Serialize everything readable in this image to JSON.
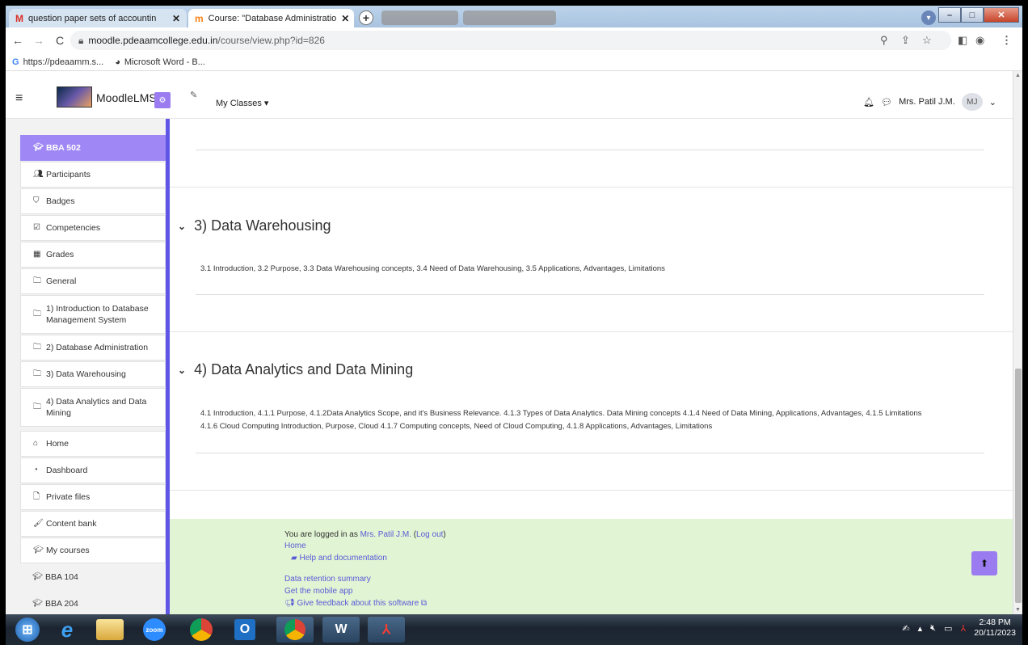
{
  "browser": {
    "tabs": [
      {
        "label": "question paper sets of accountin",
        "icon": "gmail-icon",
        "active": false
      },
      {
        "label": "Course: \"Database Administratio",
        "icon": "moodle-icon",
        "active": true
      }
    ],
    "url_domain": "moodle.pdeaamcollege.edu.in",
    "url_path": "/course/view.php?id=826",
    "bookmarks": [
      {
        "label": "https://pdeaamm.s...",
        "icon": "google-icon"
      },
      {
        "label": "Microsoft Word - B...",
        "icon": "globe-icon"
      }
    ]
  },
  "header": {
    "brand": "MoodleLMS",
    "my_classes": "My Classes ▾",
    "user_name": "Mrs. Patil J.M.",
    "user_initials": "MJ"
  },
  "sidebar": {
    "items": [
      {
        "label": "BBA 502",
        "icon": "graduation-cap-icon",
        "active": true
      },
      {
        "label": "Participants",
        "icon": "users-icon"
      },
      {
        "label": "Badges",
        "icon": "shield-icon"
      },
      {
        "label": "Competencies",
        "icon": "check-square-icon"
      },
      {
        "label": "Grades",
        "icon": "table-icon"
      },
      {
        "label": "General",
        "icon": "folder-icon"
      },
      {
        "label": "1) Introduction to Database Management System",
        "icon": "folder-icon"
      },
      {
        "label": "2) Database Administration",
        "icon": "folder-icon"
      },
      {
        "label": "3) Data Warehousing",
        "icon": "folder-icon"
      },
      {
        "label": "4) Data Analytics and Data Mining",
        "icon": "folder-icon"
      },
      {
        "label": "Home",
        "icon": "home-icon"
      },
      {
        "label": "Dashboard",
        "icon": "dashboard-icon"
      },
      {
        "label": "Private files",
        "icon": "file-icon"
      },
      {
        "label": "Content bank",
        "icon": "brush-icon"
      },
      {
        "label": "My courses",
        "icon": "graduation-cap-icon"
      },
      {
        "label": "BBA 104",
        "icon": "graduation-cap-icon"
      },
      {
        "label": "BBA 204",
        "icon": "graduation-cap-icon"
      }
    ]
  },
  "sections": [
    {
      "title": "3) Data Warehousing",
      "summary_lines": [
        "3.1 Introduction, 3.2 Purpose, 3.3 Data Warehousing concepts, 3.4 Need of Data Warehousing, 3.5 Applications, Advantages, Limitations"
      ]
    },
    {
      "title": "4) Data Analytics and Data Mining",
      "summary_lines": [
        "4.1 Introduction, 4.1.1 Purpose, 4.1.2Data Analytics Scope, and it's Business Relevance. 4.1.3 Types of Data Analytics. Data Mining concepts 4.1.4 Need of Data Mining, Applications, Advantages, 4.1.5 Limitations",
        "4.1.6 Cloud Computing Introduction, Purpose, Cloud 4.1.7 Computing concepts, Need of Cloud Computing, 4.1.8 Applications, Advantages, Limitations"
      ]
    }
  ],
  "footer": {
    "logged_in_prefix": "You are logged in as ",
    "user_link": "Mrs. Patil J.M.",
    "logout_open": " (",
    "logout": "Log out",
    "logout_close": ")",
    "home": "Home",
    "help": "Help and documentation",
    "data_retention": "Data retention summary",
    "mobile_app": "Get the mobile app",
    "feedback": "Give feedback about this software"
  },
  "taskbar": {
    "time": "2:48 PM",
    "date": "20/11/2023",
    "apps": [
      "start",
      "internet-explorer",
      "file-explorer",
      "zoom",
      "chrome",
      "outlook",
      "chrome-2",
      "word",
      "acrobat"
    ],
    "zoom_label": "zoom"
  },
  "colors": {
    "accent": "#9f88f5",
    "sidebar_border": "#5f56e6",
    "footer_bg": "#e1f4d3",
    "link": "#5a5bd8"
  }
}
